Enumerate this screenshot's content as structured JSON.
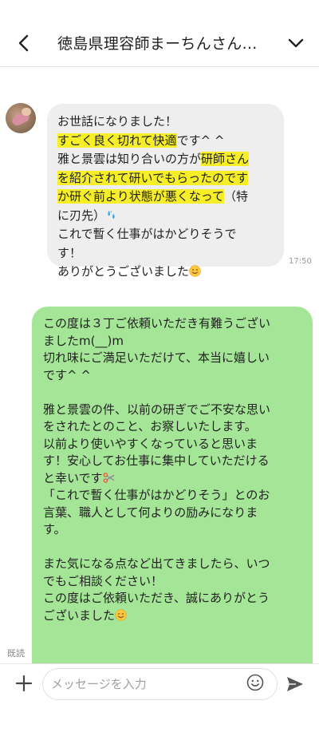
{
  "header": {
    "title": "徳島県理容師まーちんさん...",
    "back_icon": "chevron-left-icon",
    "menu_icon": "chevron-down-icon"
  },
  "incoming": {
    "avatar_icon": "user-avatar-image",
    "lines": [
      [
        {
          "t": "お世話になりました！"
        }
      ],
      [
        {
          "t": "すごく良く切れて快適",
          "hl": true
        },
        {
          "t": "です^ ^"
        }
      ],
      [
        {
          "t": "雅と景雲は知り合いの方が"
        },
        {
          "t": "研師さん",
          "hl": true
        }
      ],
      [
        {
          "t": "を紹介されて研いでもらったのです",
          "hl": true
        }
      ],
      [
        {
          "t": "か研ぐ前より状態が悪くなって",
          "hl": true
        },
        {
          "t": "（特"
        }
      ],
      [
        {
          "t": "に刃先）"
        },
        {
          "e": "sweat"
        }
      ],
      [
        {
          "t": "これで暫く仕事がはかどりそうで"
        }
      ],
      [
        {
          "t": "す！"
        }
      ],
      [
        {
          "t": "ありがとうございました"
        },
        {
          "e": "smile"
        }
      ]
    ],
    "time": "17:50"
  },
  "outgoing": {
    "lines": [
      [
        {
          "t": "この度は３丁ご依頼いただき有難うござい"
        }
      ],
      [
        {
          "t": "ましたm(__)m"
        }
      ],
      [
        {
          "t": "切れ味にご満足いただけて、本当に嬉しい"
        }
      ],
      [
        {
          "t": "です^ ^"
        }
      ],
      [],
      [
        {
          "t": "雅と景雲の件、以前の研ぎでご不安な思い"
        }
      ],
      [
        {
          "t": "をされたとのこと、お察しいたします。"
        }
      ],
      [
        {
          "t": "以前より使いやすくなっていると思いま"
        }
      ],
      [
        {
          "t": "す！安心してお仕事に集中していただける"
        }
      ],
      [
        {
          "t": "と幸いです"
        },
        {
          "e": "scissors"
        }
      ],
      [
        {
          "t": "「これで暫く仕事がはかどりそう」とのお"
        }
      ],
      [
        {
          "t": "言葉、職人として何よりの励みになりま"
        }
      ],
      [
        {
          "t": "す。"
        }
      ],
      [],
      [
        {
          "t": "また気になる点など出てきましたら、いつ"
        }
      ],
      [
        {
          "t": "でもご相談ください！"
        }
      ],
      [
        {
          "t": "この度はご依頼いただき、誠にありがとう"
        }
      ],
      [
        {
          "t": "ございました"
        },
        {
          "e": "smile"
        }
      ]
    ],
    "read_label": "既読"
  },
  "composer": {
    "plus_icon": "plus-icon",
    "placeholder": "メッセージを入力",
    "emoji_icon": "smiley-icon",
    "send_icon": "send-icon"
  },
  "colors": {
    "incoming_bubble": "#eeeeef",
    "outgoing_bubble": "#a5e597",
    "highlight": "#f6ef27"
  }
}
